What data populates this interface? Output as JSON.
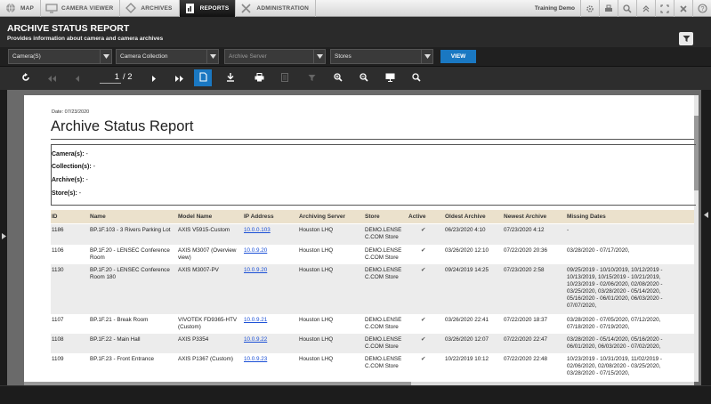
{
  "nav": {
    "tabs": [
      {
        "label": "MAP",
        "icon": "globe-icon"
      },
      {
        "label": "CAMERA VIEWER",
        "icon": "monitor-icon"
      },
      {
        "label": "ARCHIVES",
        "icon": "diamond-icon"
      },
      {
        "label": "REPORTS",
        "icon": "report-icon"
      },
      {
        "label": "ADMINISTRATION",
        "icon": "tools-icon"
      }
    ],
    "active_tab": "REPORTS",
    "user": "Training Demo",
    "right_icons": [
      "gear-icon",
      "print-icon",
      "search-icon",
      "collapse-icon",
      "fullscreen-icon",
      "close-icon",
      "help-icon"
    ]
  },
  "page": {
    "title": "ARCHIVE STATUS REPORT",
    "subtitle": "Provides information about camera and camera archives"
  },
  "filters": {
    "cameras": "Camera(S)",
    "collection": "Camera Collection",
    "server": "Archive Server",
    "stores": "Stores",
    "view_label": "VIEW"
  },
  "toolbar": {
    "current_page": "1",
    "total_pages": "/ 2"
  },
  "report": {
    "date_label": "Date: 07/23/2020",
    "title": "Archive Status Report",
    "criteria": [
      {
        "label": "Camera(s):",
        "value": "-"
      },
      {
        "label": "Collection(s):",
        "value": "-"
      },
      {
        "label": "Archive(s):",
        "value": "-"
      },
      {
        "label": "Store(s):",
        "value": "-"
      }
    ],
    "columns": [
      "ID",
      "Name",
      "Model Name",
      "IP Address",
      "Archiving Server",
      "Store",
      "Active",
      "Oldest Archive",
      "Newest Archive",
      "Missing Dates"
    ],
    "rows": [
      {
        "id": "1186",
        "name": "BP.1F.103 - 3 Rivers Parking Lot",
        "model": "AXIS V5915-Custom",
        "ip": "10.0.0.103",
        "server": "Houston LHQ",
        "store": "DEMO.LENSE C.COM Store",
        "active": "✔",
        "oldest": "06/23/2020 4:10",
        "newest": "07/23/2020 4:12",
        "missing": "-"
      },
      {
        "id": "1106",
        "name": "BP.1F.20 - LENSEC Conference Room",
        "model": "AXIS M3007 (Overview view)",
        "ip": "10.0.9.20",
        "server": "Houston LHQ",
        "store": "DEMO.LENSE C.COM Store",
        "active": "✔",
        "oldest": "03/26/2020 12:10",
        "newest": "07/22/2020 20:36",
        "missing": "03/28/2020 - 07/17/2020,"
      },
      {
        "id": "1130",
        "name": "BP.1F.20 - LENSEC Conference Room 180",
        "model": "AXIS M3007-PV",
        "ip": "10.0.9.20",
        "server": "Houston LHQ",
        "store": "DEMO.LENSE C.COM Store",
        "active": "✔",
        "oldest": "09/24/2019 14:25",
        "newest": "07/23/2020 2:58",
        "missing": "09/25/2019 - 10/10/2019, 10/12/2019 - 10/13/2019, 10/15/2019 - 10/21/2019, 10/23/2019 - 02/06/2020, 02/08/2020 - 03/25/2020, 03/28/2020 - 05/14/2020, 05/16/2020 - 06/01/2020, 06/03/2020 - 07/07/2020,"
      },
      {
        "id": "1107",
        "name": "BP.1F.21 - Break Room",
        "model": "VIVOTEK FD9365-HTV (Custom)",
        "ip": "10.0.9.21",
        "server": "Houston LHQ",
        "store": "DEMO.LENSE C.COM Store",
        "active": "✔",
        "oldest": "03/26/2020 22:41",
        "newest": "07/22/2020 18:37",
        "missing": "03/28/2020 - 07/05/2020, 07/12/2020, 07/18/2020 - 07/19/2020,"
      },
      {
        "id": "1108",
        "name": "BP.1F.22 - Main Hall",
        "model": "AXIS P3354",
        "ip": "10.0.9.22",
        "server": "Houston LHQ",
        "store": "DEMO.LENSE C.COM Store",
        "active": "✔",
        "oldest": "03/26/2020 12:07",
        "newest": "07/22/2020 22:47",
        "missing": "03/28/2020 - 05/14/2020, 05/16/2020 - 06/01/2020, 06/03/2020 - 07/02/2020,"
      },
      {
        "id": "1109",
        "name": "BP.1F.23 - Front Entrance",
        "model": "AXIS P1367 (Custom)",
        "ip": "10.0.9.23",
        "server": "Houston LHQ",
        "store": "DEMO.LENSE C.COM Store",
        "active": "✔",
        "oldest": "10/22/2019 10:12",
        "newest": "07/22/2020 22:48",
        "missing": "10/23/2019 - 10/31/2019, 11/02/2019 - 02/06/2020, 02/08/2020 - 03/25/2020, 03/28/2020 - 07/15/2020,"
      }
    ]
  }
}
